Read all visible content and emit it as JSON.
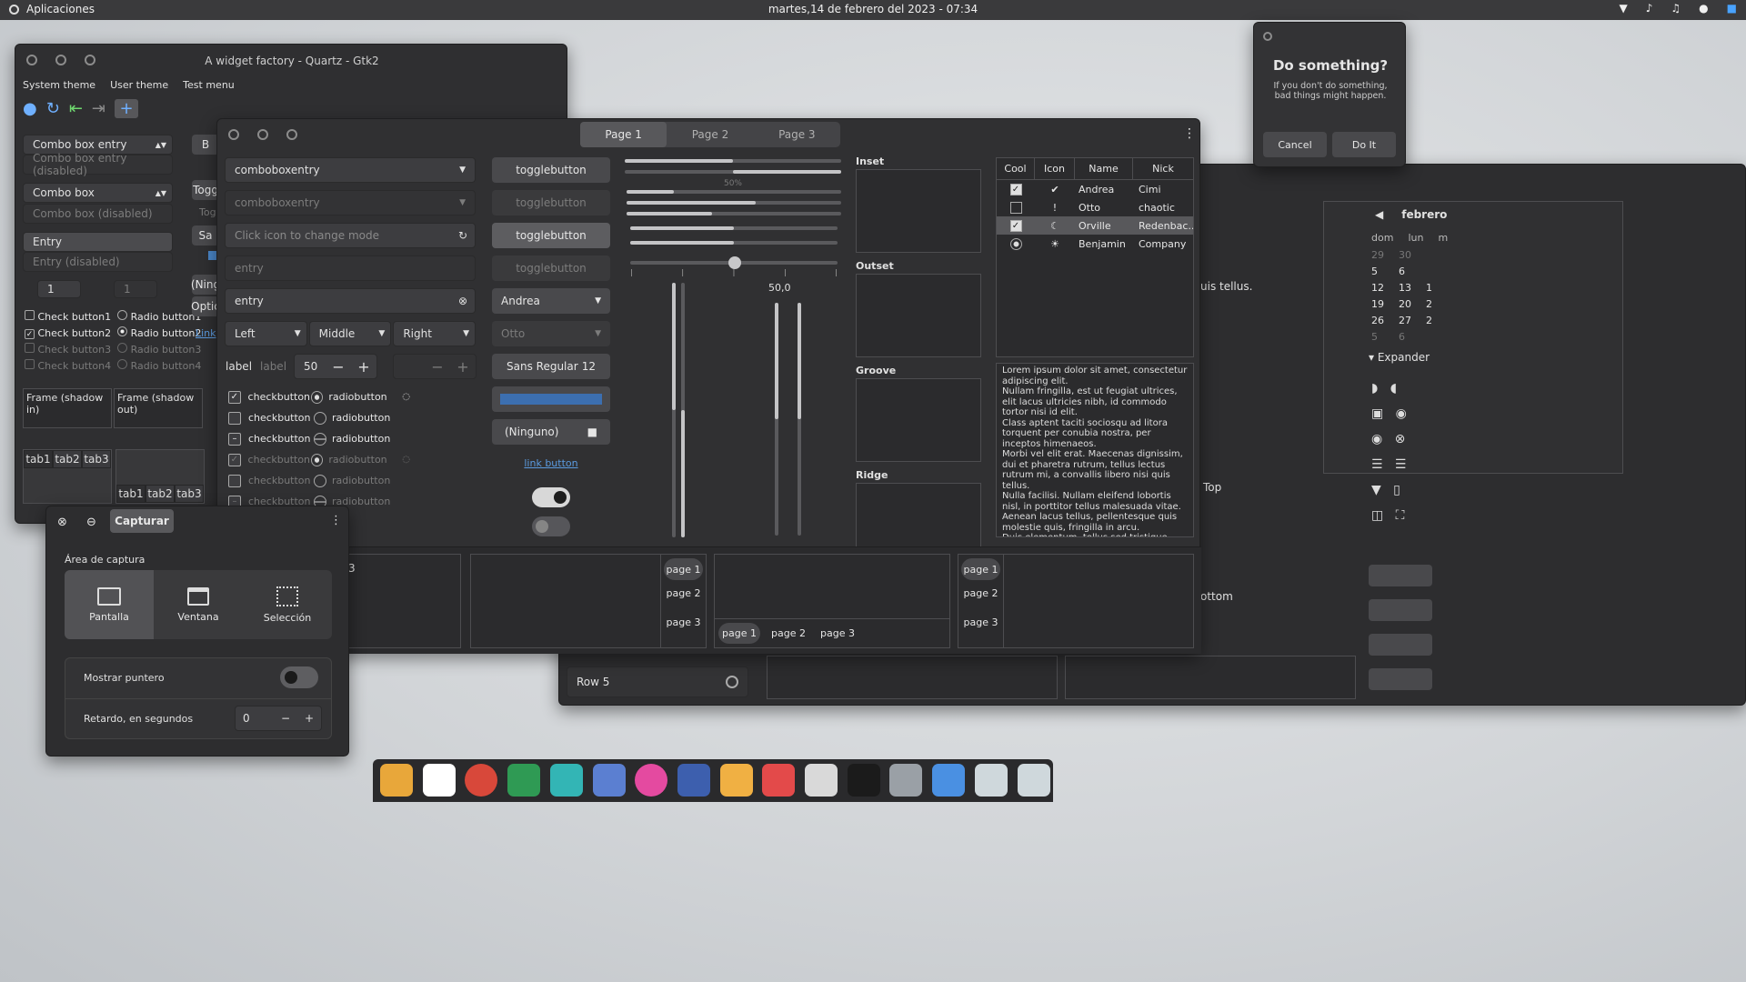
{
  "topbar": {
    "apps": "Aplicaciones",
    "clock": "martes,14 de febrero del 2023 - 07:34"
  },
  "wf": {
    "title": "A widget factory - Quartz - Gtk2",
    "menu": [
      "System theme",
      "User theme",
      "Test menu"
    ],
    "combo_entry": "Combo box entry",
    "combo_entry_dis": "Combo box entry (disabled)",
    "combo": "Combo box",
    "combo_dis": "Combo box (disabled)",
    "entry": "Entry",
    "entry_dis": "Entry (disabled)",
    "spin1": "1",
    "spin2": "1",
    "checks": [
      "Check button1",
      "Check button2",
      "Check button3",
      "Check button4"
    ],
    "radios": [
      "Radio button1",
      "Radio button2",
      "Radio button3",
      "Radio button4"
    ],
    "frame_in": "Frame (shadow in)",
    "frame_out": "Frame (shadow out)",
    "tabs": [
      "tab1",
      "tab2",
      "tab3"
    ],
    "peek": [
      "B",
      "Togg",
      "Togg",
      "Sa",
      "(Ning",
      "Optic",
      "Link"
    ]
  },
  "gtk3": {
    "pages": [
      "Page 1",
      "Page 2",
      "Page 3"
    ],
    "col1": {
      "combo1": "comboboxentry",
      "combo2": "comboboxentry",
      "icon_entry": "Click icon to change mode",
      "entry": "entry",
      "entry2": "entry",
      "left": "Left",
      "middle": "Middle",
      "right": "Right",
      "label1": "label",
      "label2": "label",
      "spin": "50",
      "checkbutton": "checkbutton",
      "radiobutton": "radiobutton"
    },
    "col2": {
      "toggle": "togglebutton",
      "andrea": "Andrea",
      "otto": "Otto",
      "font": "Sans Regular",
      "font_size": "12",
      "file": "(Ninguno)",
      "link": "link button"
    },
    "scales": {
      "pct": "50%",
      "value": "50,0",
      "progress": 0.5
    },
    "frames": [
      "Inset",
      "Outset",
      "Groove",
      "Ridge"
    ],
    "tree": {
      "headers": [
        "Cool",
        "Icon",
        "Name",
        "Nick"
      ],
      "rows": [
        {
          "name": "Andrea",
          "nick": "Cimi"
        },
        {
          "name": "Otto",
          "nick": "chaotic"
        },
        {
          "name": "Orville",
          "nick": "Redenbac..."
        },
        {
          "name": "Benjamin",
          "nick": "Company"
        }
      ]
    },
    "lorem": "Lorem ipsum dolor sit amet, consectetur adipiscing elit.\nNullam fringilla, est ut feugiat ultrices, elit lacus ultricies nibh, id commodo tortor nisi id elit.\nClass aptent taciti sociosqu ad litora torquent per conubia nostra, per inceptos himenaeos.\nMorbi vel elit erat. Maecenas dignissim, dui et pharetra rutrum, tellus lectus rutrum mi, a convallis libero nisi quis tellus.\nNulla facilisi. Nullam eleifend lobortis nisl, in porttitor tellus malesuada vitae.\nAenean lacus tellus, pellentesque quis molestie quis, fringilla in arcu.\nDuis elementum, tellus sed tristique semper, metus metus accumsan augue, et porttitor augue orci a libero.",
    "nb_pages": [
      "page 1",
      "page 2",
      "page 3"
    ],
    "nb_peek": "3"
  },
  "dialog": {
    "title": "Do something?",
    "text": "If you don't do something,\nbad things might happen.",
    "cancel": "Cancel",
    "ok": "Do It"
  },
  "back": {
    "month": "febrero",
    "days": [
      "dom",
      "lun",
      "m"
    ],
    "weeks": [
      [
        "29",
        "30",
        ""
      ],
      [
        "5",
        "6",
        ""
      ],
      [
        "12",
        "13",
        "1"
      ],
      [
        "19",
        "20",
        "2"
      ],
      [
        "26",
        "27",
        "2"
      ],
      [
        "5",
        "6",
        ""
      ]
    ],
    "expander": "Expander",
    "tellus": "uis tellus.",
    "top": "Top",
    "bottom": "ottom",
    "row5": "Row 5"
  },
  "capture": {
    "title": "Capturar",
    "area": "Área de captura",
    "modes": [
      "Pantalla",
      "Ventana",
      "Selección"
    ],
    "pointer": "Mostrar puntero",
    "delay": "Retardo, en segundos",
    "delay_val": "0"
  },
  "dock": {
    "apps": [
      "files-icon",
      "store-icon",
      "chrome-icon",
      "sheets-icon",
      "camera-icon",
      "photos-icon",
      "spiral-icon",
      "video-icon",
      "mail-icon",
      "calendar-icon",
      "editor-icon",
      "terminal-icon",
      "settings-icon",
      "gimp-icon",
      "tweaks-icon",
      "widget-icon"
    ]
  }
}
